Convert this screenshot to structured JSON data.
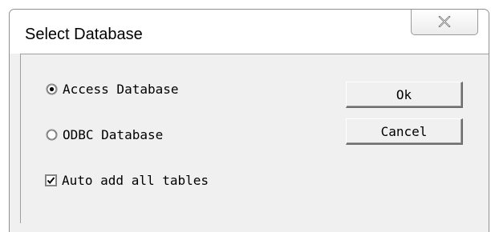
{
  "dialog": {
    "title": "Select Database",
    "close_icon": "close-icon"
  },
  "options": {
    "access": {
      "label": "Access Database",
      "selected": true
    },
    "odbc": {
      "label": "ODBC Database",
      "selected": false
    },
    "auto_add": {
      "label": "Auto add all tables",
      "checked": true
    }
  },
  "buttons": {
    "ok_label": "Ok",
    "cancel_label": "Cancel"
  }
}
